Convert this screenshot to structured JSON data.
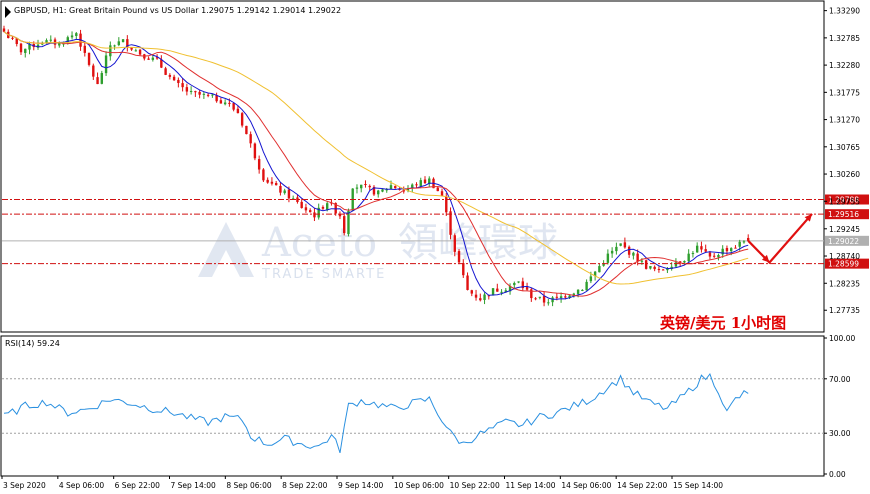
{
  "header": {
    "title": "GBPUSD, H1:  Great Britain Pound vs US Dollar  1.29075 1.29142 1.29014 1.29022",
    "annotation": "英镑/美元  1小时图"
  },
  "watermark": {
    "brand": "Aceto",
    "cn": "領峰環球",
    "sub": "TRADE SMARTE"
  },
  "rsi": {
    "label": "RSI(14) 59.24",
    "levels": [
      70,
      30
    ],
    "ticks": [
      "100.00",
      "70.00",
      "30.00",
      "0.00"
    ]
  },
  "colors": {
    "up": "#2e9e2e",
    "down": "#e01010",
    "ma_fast": "#1515d0",
    "ma_mid": "#e03030",
    "ma_slow": "#f0c030",
    "rsi": "#2a90e0",
    "level": "#d01010",
    "current": "#b0b0b0"
  },
  "chart_data": {
    "type": "candlestick",
    "symbol": "GBPUSD",
    "timeframe": "H1",
    "ylim": [
      1.2735,
      1.3345
    ],
    "y_ticks": [
      "1.33290",
      "1.32785",
      "1.32280",
      "1.31775",
      "1.31270",
      "1.30765",
      "1.30260",
      "1.29755",
      "1.29245",
      "1.28740",
      "1.28235",
      "1.27735"
    ],
    "x_ticks": [
      "3 Sep 2020",
      "4 Sep 06:00",
      "6 Sep 22:00",
      "7 Sep 14:00",
      "8 Sep 06:00",
      "8 Sep 22:00",
      "9 Sep 14:00",
      "10 Sep 06:00",
      "10 Sep 22:00",
      "11 Sep 14:00",
      "14 Sep 06:00",
      "14 Sep 22:00",
      "15 Sep 14:00"
    ],
    "current_price": "1.29022",
    "levels": [
      {
        "value": 1.29788,
        "label": "1.29788"
      },
      {
        "value": 1.29516,
        "label": "1.29516"
      },
      {
        "value": 1.28599,
        "label": "1.28599"
      }
    ],
    "anchors": [
      [
        0,
        1.329
      ],
      [
        4,
        1.3255
      ],
      [
        9,
        1.3272
      ],
      [
        13,
        1.3268
      ],
      [
        17,
        1.3288
      ],
      [
        19,
        1.3245
      ],
      [
        22,
        1.319
      ],
      [
        25,
        1.3265
      ],
      [
        28,
        1.3272
      ],
      [
        32,
        1.325
      ],
      [
        36,
        1.3235
      ],
      [
        40,
        1.3195
      ],
      [
        44,
        1.3175
      ],
      [
        48,
        1.317
      ],
      [
        52,
        1.316
      ],
      [
        55,
        1.314
      ],
      [
        58,
        1.308
      ],
      [
        61,
        1.302
      ],
      [
        64,
        1.3
      ],
      [
        67,
        1.2985
      ],
      [
        70,
        1.2965
      ],
      [
        73,
        1.295
      ],
      [
        76,
        1.2975
      ],
      [
        79,
        1.295
      ],
      [
        80,
        1.292
      ],
      [
        82,
        1.3005
      ],
      [
        85,
        1.3
      ],
      [
        88,
        1.299
      ],
      [
        91,
        1.3005
      ],
      [
        94,
        1.2995
      ],
      [
        97,
        1.3008
      ],
      [
        100,
        1.3015
      ],
      [
        103,
        1.2985
      ],
      [
        106,
        1.2885
      ],
      [
        109,
        1.281
      ],
      [
        112,
        1.2795
      ],
      [
        115,
        1.281
      ],
      [
        118,
        1.2815
      ],
      [
        121,
        1.2825
      ],
      [
        124,
        1.28
      ],
      [
        127,
        1.279
      ],
      [
        130,
        1.2795
      ],
      [
        133,
        1.2805
      ],
      [
        136,
        1.2815
      ],
      [
        139,
        1.2845
      ],
      [
        142,
        1.2875
      ],
      [
        145,
        1.2895
      ],
      [
        148,
        1.2875
      ],
      [
        151,
        1.2855
      ],
      [
        154,
        1.2845
      ],
      [
        157,
        1.286
      ],
      [
        160,
        1.287
      ],
      [
        163,
        1.289
      ],
      [
        166,
        1.287
      ],
      [
        169,
        1.2885
      ],
      [
        172,
        1.2892
      ],
      [
        174,
        1.2902
      ]
    ],
    "ma_lag": [
      {
        "name": "fast",
        "period": 6,
        "offset": 0.0
      },
      {
        "name": "mid",
        "period": 14,
        "offset": 0.0
      },
      {
        "name": "slow",
        "period": 40,
        "offset": 0.0
      }
    ],
    "forecast_path": [
      [
        175,
        1.29022
      ],
      [
        180,
        1.2862
      ],
      [
        190,
        1.2952
      ]
    ],
    "rsi_anchors": [
      [
        0,
        42
      ],
      [
        5,
        50
      ],
      [
        10,
        53
      ],
      [
        15,
        45
      ],
      [
        20,
        48
      ],
      [
        25,
        55
      ],
      [
        30,
        52
      ],
      [
        35,
        48
      ],
      [
        40,
        45
      ],
      [
        44,
        41
      ],
      [
        48,
        38
      ],
      [
        52,
        42
      ],
      [
        56,
        40
      ],
      [
        58,
        28
      ],
      [
        62,
        22
      ],
      [
        66,
        26
      ],
      [
        70,
        22
      ],
      [
        74,
        20
      ],
      [
        77,
        28
      ],
      [
        79,
        18
      ],
      [
        81,
        50
      ],
      [
        84,
        54
      ],
      [
        88,
        51
      ],
      [
        92,
        48
      ],
      [
        96,
        52
      ],
      [
        100,
        55
      ],
      [
        102,
        45
      ],
      [
        105,
        30
      ],
      [
        108,
        22
      ],
      [
        111,
        28
      ],
      [
        114,
        32
      ],
      [
        118,
        38
      ],
      [
        122,
        36
      ],
      [
        126,
        42
      ],
      [
        130,
        45
      ],
      [
        134,
        50
      ],
      [
        138,
        55
      ],
      [
        142,
        64
      ],
      [
        145,
        70
      ],
      [
        148,
        60
      ],
      [
        152,
        52
      ],
      [
        156,
        48
      ],
      [
        160,
        58
      ],
      [
        164,
        70
      ],
      [
        166,
        72
      ],
      [
        168,
        62
      ],
      [
        170,
        45
      ],
      [
        172,
        55
      ],
      [
        174,
        59
      ]
    ]
  }
}
